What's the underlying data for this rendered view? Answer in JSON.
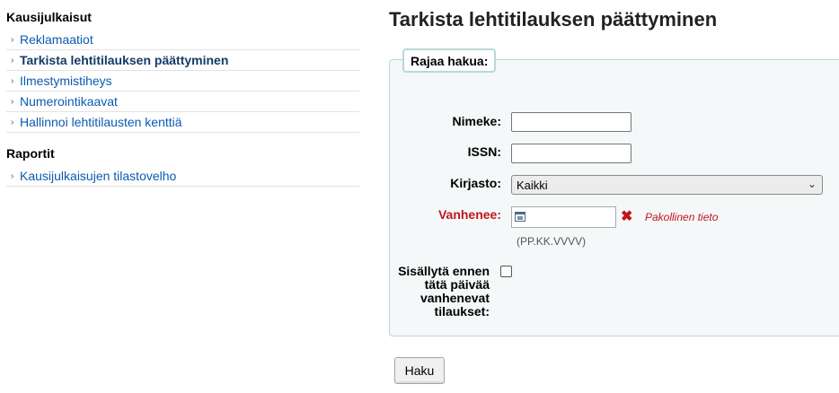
{
  "sidebar": {
    "section1_title": "Kausijulkaisut",
    "section1_items": [
      {
        "label": "Reklamaatiot"
      },
      {
        "label": "Tarkista lehtitilauksen päättyminen"
      },
      {
        "label": "Ilmestymistiheys"
      },
      {
        "label": "Numerointikaavat"
      },
      {
        "label": "Hallinnoi lehtitilausten kenttiä"
      }
    ],
    "section2_title": "Raportit",
    "section2_items": [
      {
        "label": "Kausijulkaisujen tilastovelho"
      }
    ]
  },
  "main": {
    "title": "Tarkista lehtitilauksen päättyminen",
    "legend": "Rajaa hakua:",
    "fields": {
      "title_label": "Nimeke:",
      "title_value": "",
      "issn_label": "ISSN:",
      "issn_value": "",
      "library_label": "Kirjasto:",
      "library_value": "Kaikki",
      "expires_label": "Vanhenee:",
      "expires_value": "",
      "required_msg": "Pakollinen tieto",
      "date_hint": "(PP.KK.VVVV)",
      "include_label": "Sisällytä ennen tätä päivää vanhenevat tilaukset:",
      "include_checked": false
    },
    "search_button": "Haku"
  },
  "colors": {
    "link": "#0a5bb0",
    "active_link": "#143a66",
    "required": "#c0161a",
    "box_bg": "#f4f8f9",
    "box_border": "#b9d8d9"
  }
}
